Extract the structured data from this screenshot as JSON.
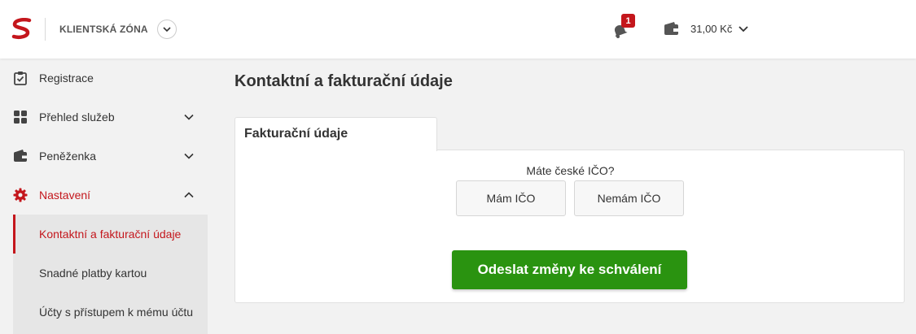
{
  "header": {
    "zone_label": "KLIENTSKÁ ZÓNA",
    "notification_count": "1",
    "balance": "31,00 Kč"
  },
  "sidebar": {
    "items": [
      {
        "label": "Registrace",
        "icon": "clipboard-check-icon"
      },
      {
        "label": "Přehled služeb",
        "icon": "grid-icon"
      },
      {
        "label": "Peněženka",
        "icon": "wallet-icon"
      },
      {
        "label": "Nastavení",
        "icon": "gear-icon"
      }
    ],
    "subitems": [
      {
        "label": "Kontaktní a fakturační údaje"
      },
      {
        "label": "Snadné platby kartou"
      },
      {
        "label": "Účty s přístupem k mému účtu"
      }
    ]
  },
  "main": {
    "title": "Kontaktní a fakturační údaje",
    "tab_label": "Fakturační údaje",
    "question": "Máte české IČO?",
    "option_yes": "Mám IČO",
    "option_no": "Nemám IČO",
    "submit_label": "Odeslat změny ke schválení"
  },
  "colors": {
    "accent": "#c4161c",
    "submit": "#2a9310"
  }
}
